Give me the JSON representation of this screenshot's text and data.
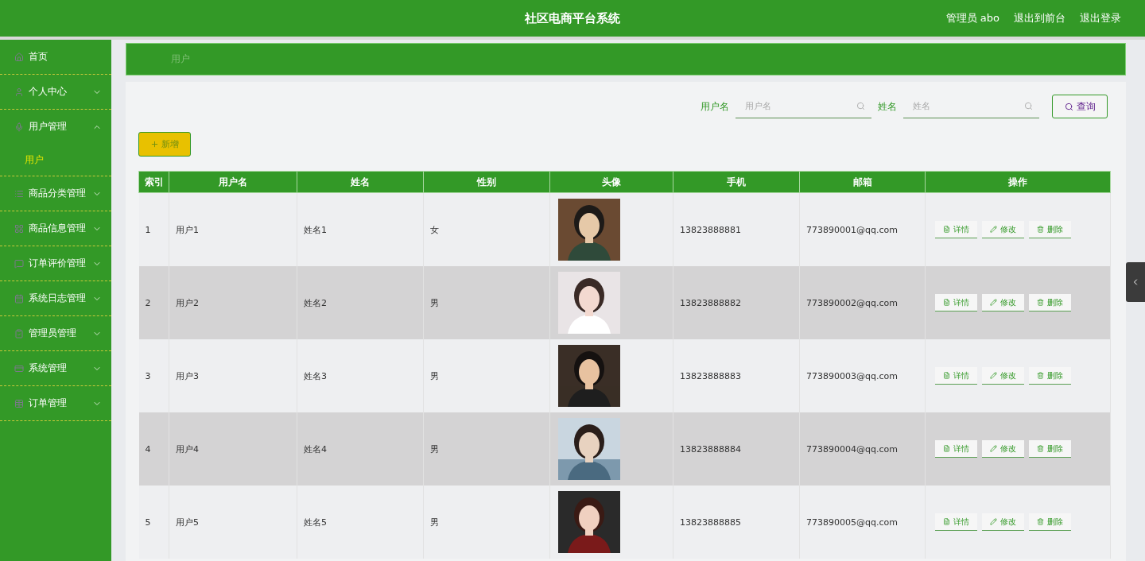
{
  "header": {
    "title": "社区电商平台系统",
    "user": "管理员 abo",
    "links": [
      "退出到前台",
      "退出登录"
    ]
  },
  "sidebar": {
    "items": [
      {
        "label": "首页",
        "kind": "link"
      },
      {
        "label": "个人中心",
        "kind": "menu",
        "expanded": false
      },
      {
        "label": "用户管理",
        "kind": "menu",
        "expanded": true,
        "children": [
          {
            "label": "用户",
            "selected": true
          }
        ]
      },
      {
        "label": "商品分类管理",
        "kind": "menu",
        "expanded": false
      },
      {
        "label": "商品信息管理",
        "kind": "menu",
        "expanded": false
      },
      {
        "label": "订单评价管理",
        "kind": "menu",
        "expanded": false
      },
      {
        "label": "系统日志管理",
        "kind": "menu",
        "expanded": false
      },
      {
        "label": "管理员管理",
        "kind": "menu",
        "expanded": false
      },
      {
        "label": "系统管理",
        "kind": "menu",
        "expanded": false
      },
      {
        "label": "订单管理",
        "kind": "menu",
        "expanded": false
      }
    ]
  },
  "breadcrumb": "用户",
  "search": {
    "fields": [
      {
        "label": "用户名",
        "placeholder": "用户名"
      },
      {
        "label": "姓名",
        "placeholder": "姓名"
      }
    ],
    "button": "查询"
  },
  "add_button": "新增",
  "table": {
    "columns": [
      "索引",
      "用户名",
      "姓名",
      "性别",
      "头像",
      "手机",
      "邮箱",
      "操作"
    ],
    "rows": [
      {
        "index": "1",
        "username": "用户1",
        "name": "姓名1",
        "gender": "女",
        "phone": "13823888881",
        "email": "773890001@qq.com",
        "actions": [
          "详情",
          "修改",
          "删除"
        ]
      },
      {
        "index": "2",
        "username": "用户2",
        "name": "姓名2",
        "gender": "男",
        "phone": "13823888882",
        "email": "773890002@qq.com",
        "actions": [
          "详情",
          "修改",
          "删除"
        ]
      },
      {
        "index": "3",
        "username": "用户3",
        "name": "姓名3",
        "gender": "男",
        "phone": "13823888883",
        "email": "773890003@qq.com",
        "actions": [
          "详情",
          "修改",
          "删除"
        ]
      },
      {
        "index": "4",
        "username": "用户4",
        "name": "姓名4",
        "gender": "男",
        "phone": "13823888884",
        "email": "773890004@qq.com",
        "actions": [
          "详情",
          "修改",
          "删除"
        ]
      },
      {
        "index": "5",
        "username": "用户5",
        "name": "姓名5",
        "gender": "男",
        "phone": "13823888885",
        "email": "773890005@qq.com",
        "actions": [
          "详情",
          "修改",
          "删除"
        ]
      }
    ]
  }
}
